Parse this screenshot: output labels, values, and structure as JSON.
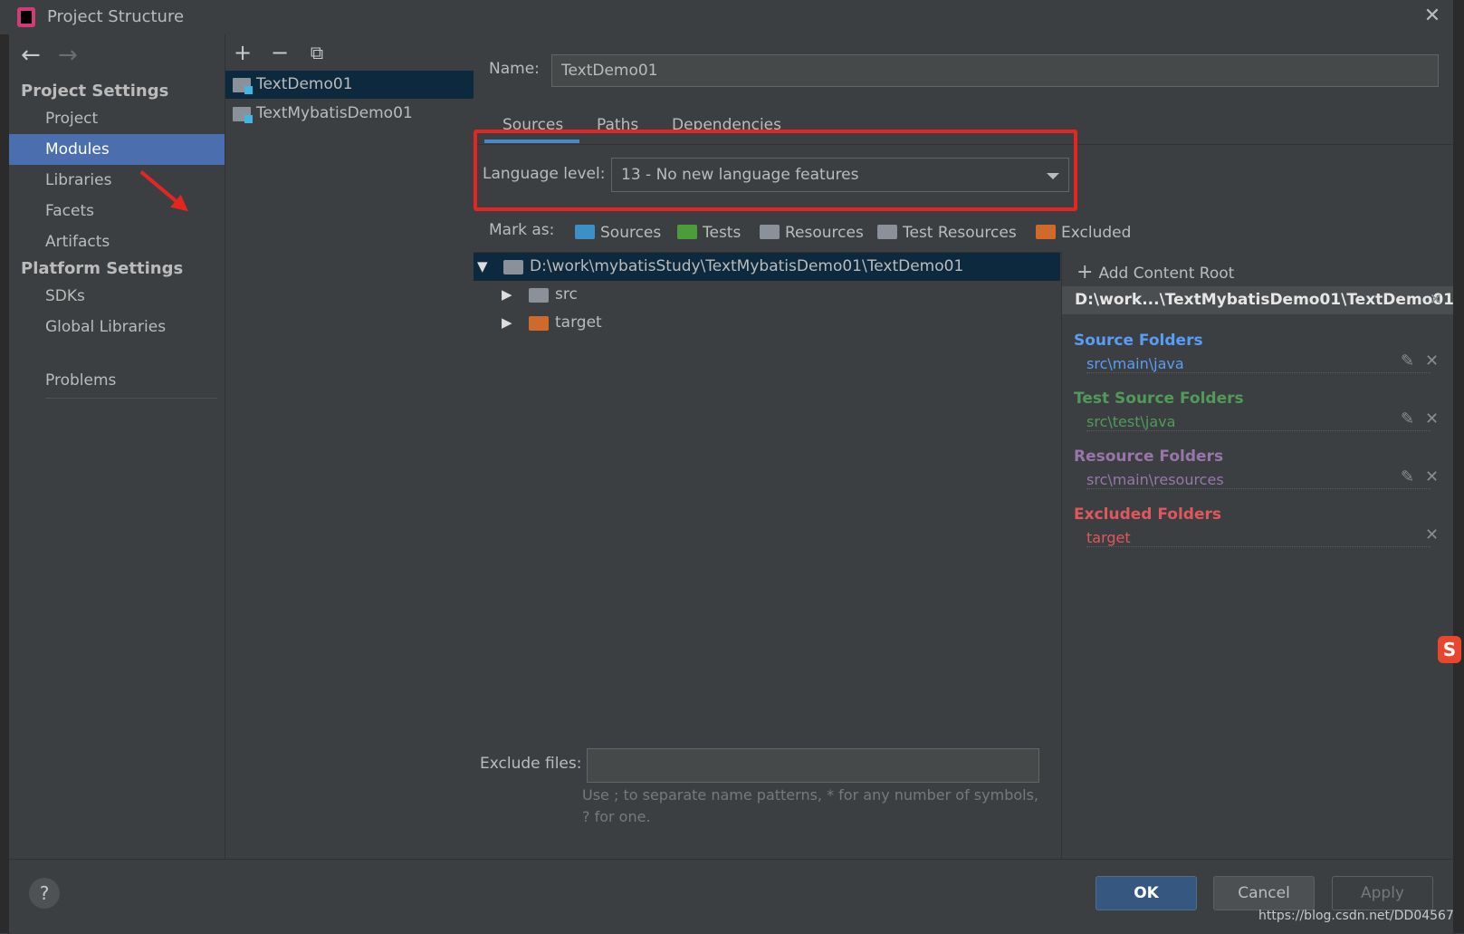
{
  "window": {
    "title": "Project Structure",
    "close": "✕"
  },
  "nav": {
    "back": "←",
    "forward": "→"
  },
  "sidebar": {
    "project_settings": "Project Settings",
    "platform_settings": "Platform Settings",
    "items": [
      {
        "label": "Project"
      },
      {
        "label": "Modules"
      },
      {
        "label": "Libraries"
      },
      {
        "label": "Facets"
      },
      {
        "label": "Artifacts"
      },
      {
        "label": "SDKs"
      },
      {
        "label": "Global Libraries"
      },
      {
        "label": "Problems"
      }
    ]
  },
  "modules": {
    "toolbar": {
      "add": "+",
      "remove": "−",
      "copy": "⧉"
    },
    "list": [
      {
        "name": "TextDemo01"
      },
      {
        "name": "TextMybatisDemo01"
      }
    ]
  },
  "details": {
    "name_label": "Name:",
    "name_value": "TextDemo01",
    "tabs": [
      {
        "label": "Sources"
      },
      {
        "label": "Paths"
      },
      {
        "label": "Dependencies"
      }
    ],
    "language_level_label": "Language level:",
    "language_level_value": "13 - No new language features",
    "mark_as_label": "Mark as:",
    "mark_as": [
      {
        "label": "Sources",
        "color": "#3d8fc7"
      },
      {
        "label": "Tests",
        "color": "#4c9d3a"
      },
      {
        "label": "Resources",
        "color": "#8a9199"
      },
      {
        "label": "Test Resources",
        "color": "#8a9199"
      },
      {
        "label": "Excluded",
        "color": "#d06a2a"
      }
    ],
    "tree": [
      {
        "label": "D:\\work\\mybatisStudy\\TextMybatisDemo01\\TextDemo01"
      },
      {
        "label": "src"
      },
      {
        "label": "target"
      }
    ],
    "exclude_label": "Exclude files:",
    "exclude_hint": "Use ; to separate name patterns, * for any number of symbols, ? for one."
  },
  "roots": {
    "add_content_root": "Add Content Root",
    "root_path": "D:\\work...\\TextMybatisDemo01\\TextDemo01",
    "groups": [
      {
        "title": "Source Folders",
        "path": "src\\main\\java",
        "color": "#589df6"
      },
      {
        "title": "Test Source Folders",
        "path": "src\\test\\java",
        "color": "#509a5a"
      },
      {
        "title": "Resource Folders",
        "path": "src\\main\\resources",
        "color": "#9876aa"
      },
      {
        "title": "Excluded Folders",
        "path": "target",
        "color": "#e0575d"
      }
    ]
  },
  "footer": {
    "help": "?",
    "ok": "OK",
    "cancel": "Cancel",
    "apply": "Apply"
  },
  "watermark": "https://blog.csdn.net/DD04567",
  "ime_badge": "S"
}
